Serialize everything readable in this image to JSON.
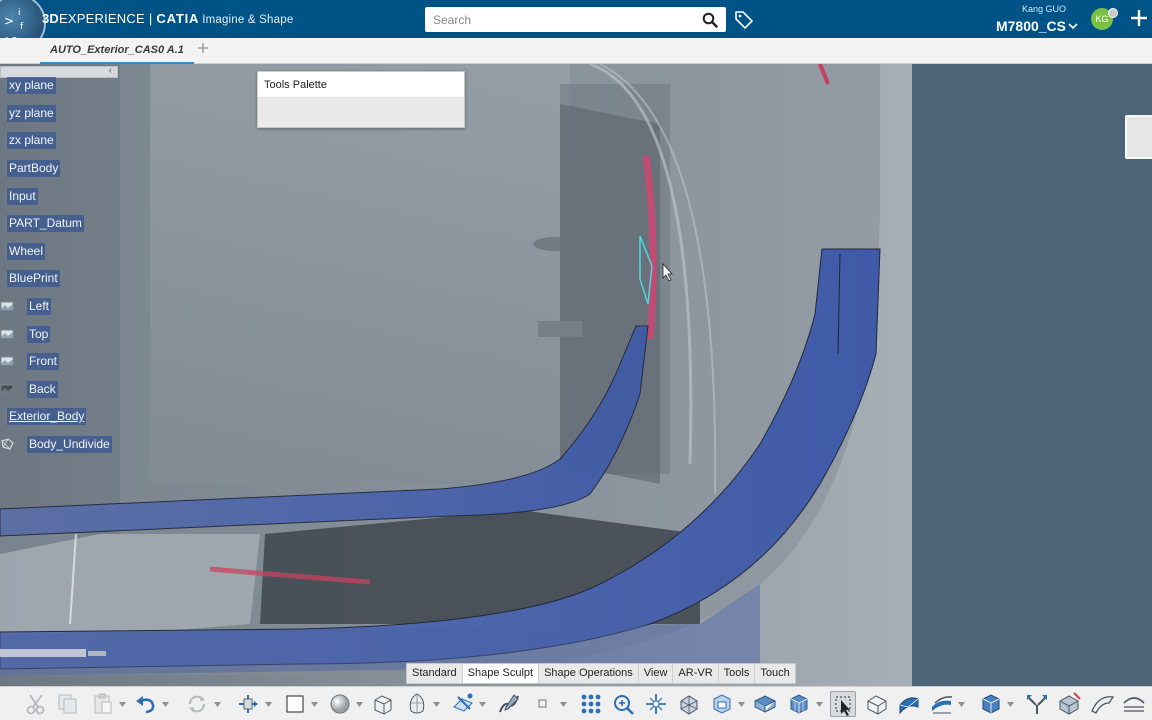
{
  "topbar": {
    "brand_3d": "3D",
    "brand_experience": "EXPERIENCE",
    "brand_separator": "|",
    "brand_app": "CATIA",
    "brand_context": "Imagine & Shape",
    "compass_letters": [
      ">",
      "i",
      "f",
      "A",
      "R"
    ],
    "search_placeholder": "Search",
    "user_name": "Kang GUO",
    "tenant": "M7800_CS",
    "avatar_initials": "KG",
    "icons": [
      "compass-icon",
      "search-icon",
      "tag-icon",
      "chevron-down-icon",
      "plus-icon"
    ]
  },
  "tabs": [
    {
      "label": "AUTO_Exterior_CAS0 A.1",
      "active": true
    }
  ],
  "tree": {
    "collapse_glyph": "‹",
    "items": [
      {
        "label": "xy plane",
        "icon": ""
      },
      {
        "label": "yz plane",
        "icon": ""
      },
      {
        "label": "zx plane",
        "icon": ""
      },
      {
        "label": "PartBody",
        "icon": ""
      },
      {
        "label": "Input",
        "icon": ""
      },
      {
        "label": "PART_Datum",
        "icon": ""
      },
      {
        "label": "Wheel",
        "icon": ""
      },
      {
        "label": "BluePrint",
        "icon": ""
      },
      {
        "label": "Left",
        "icon": "image-icon"
      },
      {
        "label": "Top",
        "icon": "image-icon"
      },
      {
        "label": "Front",
        "icon": "image-icon"
      },
      {
        "label": "Back",
        "icon": "image-icon"
      },
      {
        "label": "Exterior_Body",
        "icon": ""
      },
      {
        "label": "Body_Undivide",
        "icon": "subdivision-body-icon"
      }
    ]
  },
  "palette": {
    "title": "Tools Palette"
  },
  "section_tabs": [
    {
      "label": "Standard",
      "active": false
    },
    {
      "label": "Shape Sculpt",
      "active": true
    },
    {
      "label": "Shape Operations",
      "active": false
    },
    {
      "label": "View",
      "active": false
    },
    {
      "label": "AR-VR",
      "active": false
    },
    {
      "label": "Tools",
      "active": false
    },
    {
      "label": "Touch",
      "active": false
    }
  ],
  "action_bar": {
    "icons": [
      "cut-icon",
      "copy-icon",
      "paste-icon",
      "undo-icon",
      "update-icon",
      "transform-icon",
      "primitive-box-icon",
      "primitive-sphere-icon",
      "primitive-cylinder-icon",
      "primitive-torus-icon",
      "sketch-icon",
      "curve-icon",
      "point-icon",
      "grid-icon",
      "subdivide-icon",
      "split-icon",
      "extrude-icon",
      "bridge-icon",
      "mirror-icon",
      "lattice-icon",
      "selection-icon",
      "body-icon",
      "surface-icon",
      "offset-icon",
      "cage-icon",
      "merge-icon",
      "fill-icon",
      "trim-icon",
      "measure-icon"
    ]
  },
  "colors": {
    "topbar": "#005386",
    "viewport_background": "#4b6478",
    "tree_highlight": "#3a5891",
    "selection_accent": "#2d8bcf"
  }
}
